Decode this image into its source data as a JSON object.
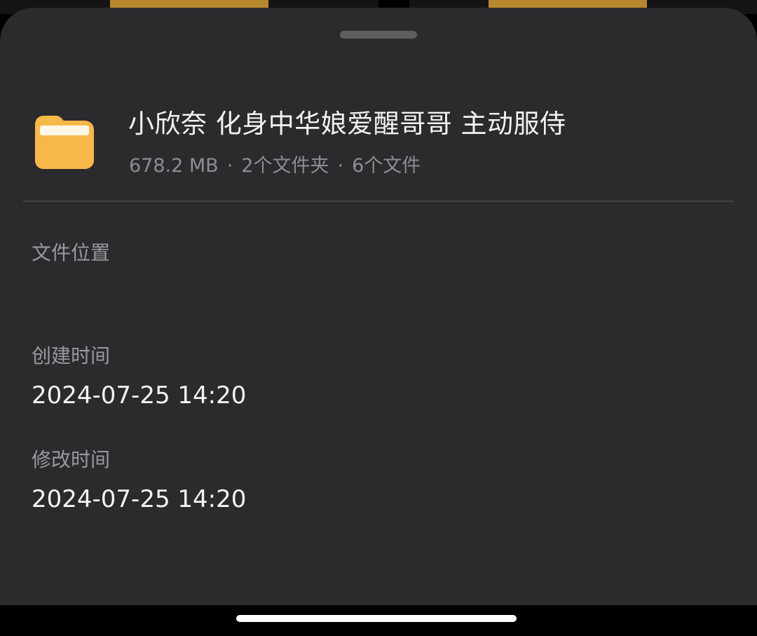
{
  "colors": {
    "sheet_background": "#2b2b2d",
    "folder_icon": "#f7b84a",
    "title_text": "#f2f2f2",
    "secondary_text": "#8e8e92"
  },
  "header": {
    "icon": "folder-icon",
    "title": "小欣奈 化身中华娘爱醒哥哥 主动服侍",
    "size": "678.2 MB",
    "folders": "2个文件夹",
    "files": "6个文件",
    "separator": "·"
  },
  "details": {
    "location_label": "文件位置",
    "created_label": "创建时间",
    "created_value": "2024-07-25 14:20",
    "modified_label": "修改时间",
    "modified_value": "2024-07-25 14:20"
  }
}
